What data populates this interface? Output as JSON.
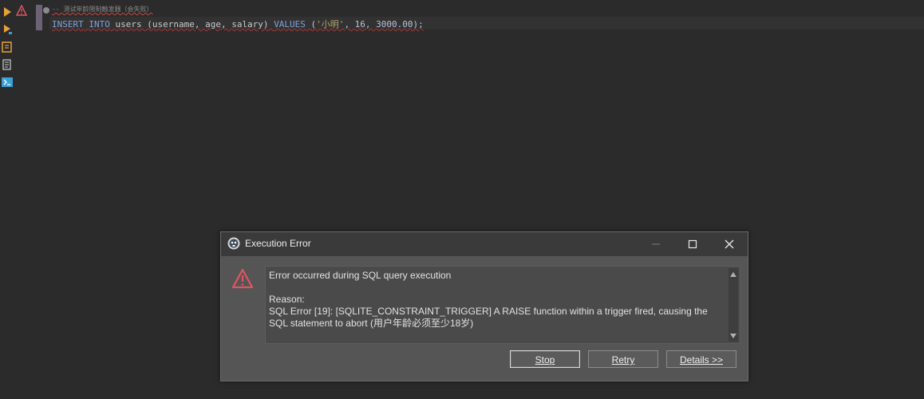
{
  "editor": {
    "comment_line": "-- 测试年龄限制触发器（会失败）",
    "sql": {
      "kw_insert": "INSERT",
      "kw_into": "INTO",
      "table_part": " users (username, age, salary) ",
      "kw_values": "VALUES",
      "open": " (",
      "str_value": "'小明'",
      "rest": ", 16, 3000.00);"
    }
  },
  "dialog": {
    "title": "Execution Error",
    "message_line1": "Error occurred during SQL query execution",
    "reason_label": "Reason:",
    "reason_text": "SQL Error [19]: [SQLITE_CONSTRAINT_TRIGGER] A RAISE function within a trigger fired, causing the SQL statement to abort (用户年龄必须至少18岁)",
    "buttons": {
      "stop": "Stop",
      "retry": "Retry",
      "details": "Details >>"
    }
  },
  "colors": {
    "accent_orange": "#e8a13a",
    "error_red": "#e05561",
    "terminal_blue": "#3aa0d8"
  }
}
